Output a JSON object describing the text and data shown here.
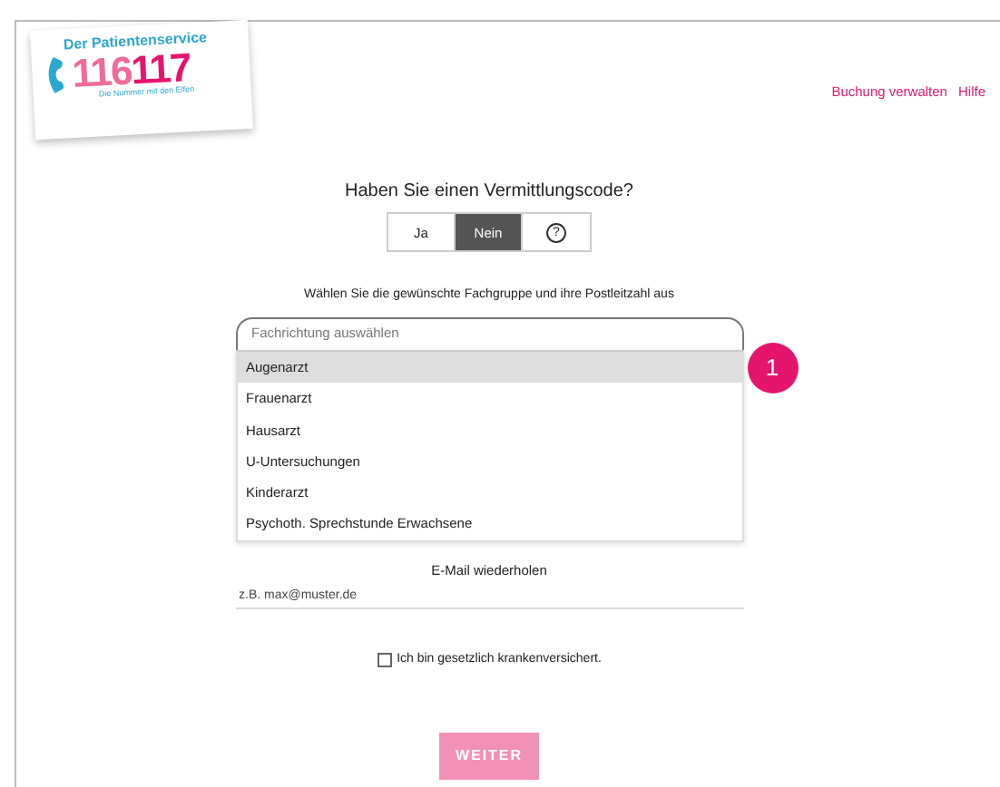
{
  "logo": {
    "caption": "Der Patientenservice",
    "number_part_1": "116",
    "number_part_2": "117",
    "tagline": "Die Nummer mit den Elfen"
  },
  "header_links": [
    "Buchung verwalten",
    "Hilfe"
  ],
  "question": "Haben Sie einen Vermittlungscode?",
  "code_toggle": [
    {
      "label": "Ja",
      "selected": false
    },
    {
      "label": "Nein",
      "selected": true
    },
    {
      "label": "?",
      "kind": "help",
      "selected": false
    }
  ],
  "instruction": "Wählen Sie die gewünschte Fachgruppe und ihre Postleitzahl aus",
  "specialty_select": {
    "placeholder": "Fachrichtung auswählen",
    "options": [
      {
        "label": "Augenarzt",
        "selected": true
      },
      {
        "label": "Frauenarzt",
        "selected": false
      },
      {
        "label": "Hausarzt",
        "selected": false
      },
      {
        "label": "U-Untersuchungen",
        "selected": false
      },
      {
        "label": "Kinderarzt",
        "selected": false
      },
      {
        "label": "Psychoth. Sprechstunde Erwachsene",
        "selected": false
      }
    ]
  },
  "callout_badge": "1",
  "email_repeat": {
    "label": "E-Mail wiederholen",
    "placeholder": "z.B. max@muster.de"
  },
  "insurance_checkbox": {
    "label": "Ich bin gesetzlich krankenversichert.",
    "checked": false
  },
  "submit_button": "WEITER"
}
